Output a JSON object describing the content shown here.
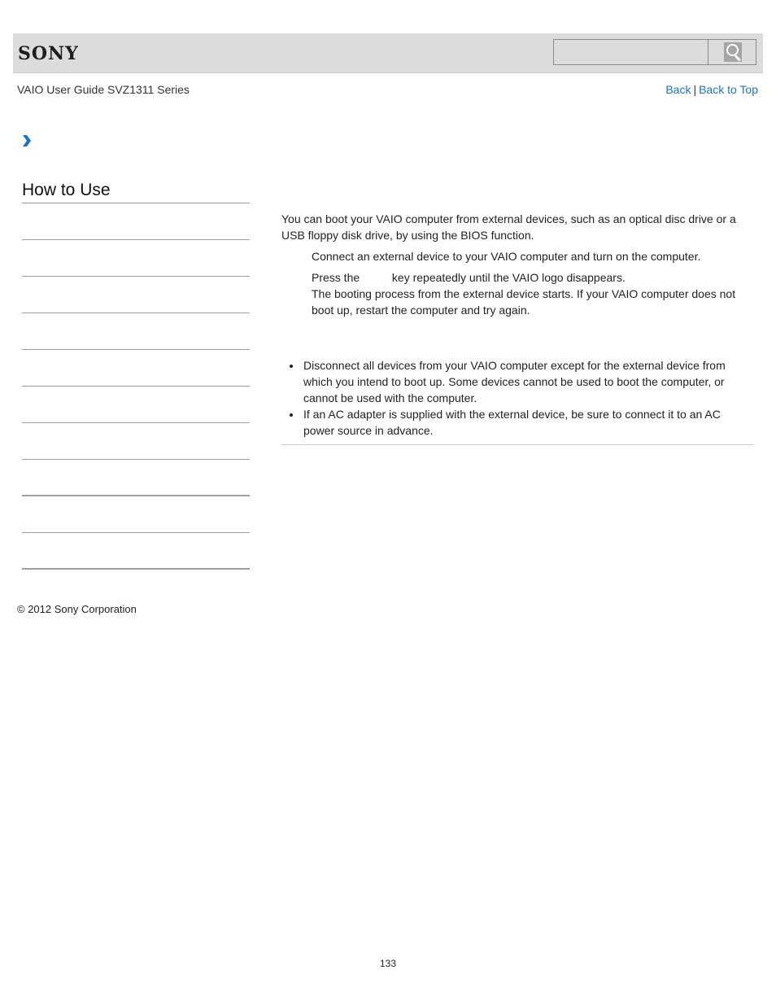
{
  "header": {
    "logo_text": "SONY",
    "search": {
      "value": "",
      "placeholder": ""
    },
    "search_icon": "magnifier-icon"
  },
  "subheader": {
    "guide_title": "VAIO User Guide SVZ1311 Series",
    "back_label": "Back",
    "separator": "|",
    "back_to_top_label": "Back to Top"
  },
  "breadcrumb": {
    "icon": "chevron-right-icon",
    "color": "#1a73c7"
  },
  "sidebar": {
    "title": "How to Use",
    "items": [
      {
        "label": ""
      },
      {
        "label": ""
      },
      {
        "label": ""
      },
      {
        "label": ""
      },
      {
        "label": ""
      },
      {
        "label": ""
      },
      {
        "label": ""
      },
      {
        "label": ""
      },
      {
        "label": ""
      },
      {
        "label": ""
      }
    ]
  },
  "main": {
    "intro": "You can boot your VAIO computer from external devices, such as an optical disc drive or a USB floppy disk drive, by using the BIOS function.",
    "steps": [
      {
        "text": "Connect an external device to your VAIO computer and turn on the computer."
      },
      {
        "text_before_key": "Press the",
        "key": "",
        "text_after_key": "key repeatedly until the VAIO logo disappears.",
        "detail": "The booting process from the external device starts. If your VAIO computer does not boot up, restart the computer and try again."
      }
    ],
    "notes": [
      "Disconnect all devices from your VAIO computer except for the external device from which you intend to boot up. Some devices cannot be used to boot the computer, or cannot be used with the computer.",
      "If an AC adapter is supplied with the external device, be sure to connect it to an AC power source in advance."
    ]
  },
  "footer": {
    "copyright": "© 2012 Sony Corporation",
    "page_number": "133"
  },
  "colors": {
    "link": "#1a73c7",
    "header_bg": "#dcdcdc",
    "divider": "#a0a0a0"
  }
}
